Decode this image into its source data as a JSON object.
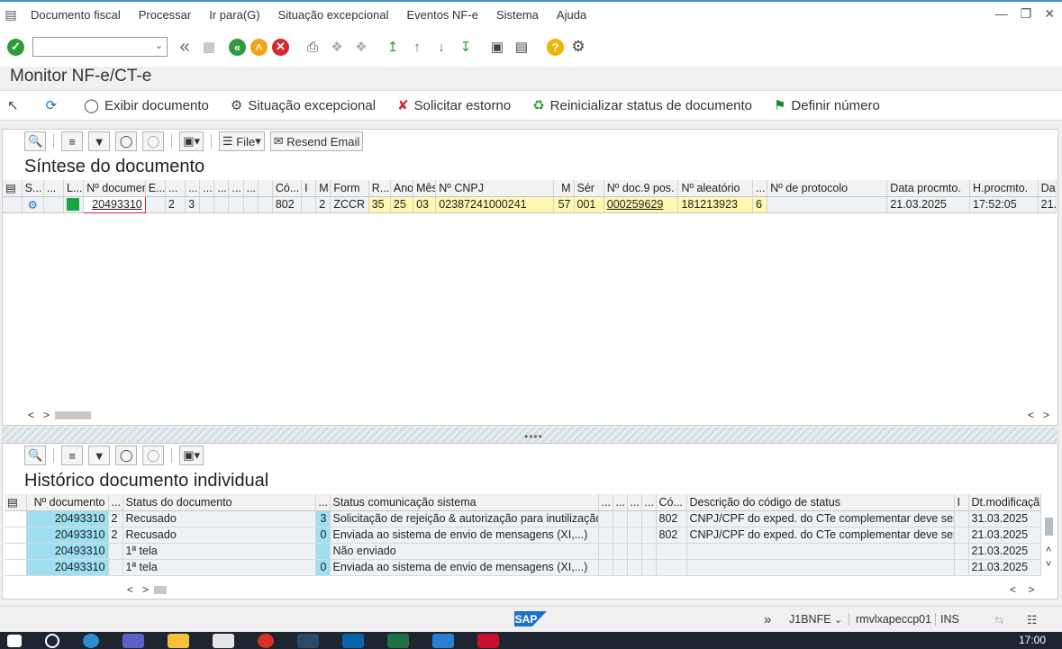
{
  "menu": {
    "items": [
      "Documento fiscal",
      "Processar",
      "Ir para(G)",
      "Situação excepcional",
      "Eventos NF-e",
      "Sistema",
      "Ajuda"
    ]
  },
  "toolbar": {
    "command_field_value": "",
    "icons": [
      "enter-icon",
      "back-double-icon",
      "save-icon",
      "back-icon",
      "exit-icon",
      "cancel-icon",
      "print-icon",
      "find-icon",
      "find-next-icon",
      "first-page-icon",
      "previous-page-icon",
      "next-page-icon",
      "last-page-icon",
      "create-session-icon",
      "shortcut-icon",
      "help-icon",
      "customize-icon"
    ]
  },
  "page": {
    "title": "Monitor NF-e/CT-e"
  },
  "app_toolbar": {
    "exibir_documento": "Exibir documento",
    "situacao_excepcional": "Situação excepcional",
    "solicitar_estorno": "Solicitar estorno",
    "reinicializar": "Reinicializar status de documento",
    "definir_numero": "Definir número"
  },
  "grid1": {
    "file_label": "File",
    "resend_label": "Resend Email",
    "title": "Síntese do documento",
    "headers": [
      "S...",
      "...",
      "L...",
      "Nº documento",
      "E...",
      "...",
      "...",
      "...",
      "...",
      "...",
      "...",
      "Có...",
      "I",
      "M",
      "Form",
      "R...",
      "Ano",
      "Mês",
      "Nº CNPJ",
      "M",
      "Sér",
      "Nº doc.9 pos.",
      "Nº aleatório",
      "...",
      "Nº de protocolo",
      "Data procmto.",
      "H.procmto.",
      "Dat"
    ],
    "row": [
      "",
      "",
      "",
      "20493310",
      "",
      "2",
      "3",
      "",
      "",
      "",
      "",
      "802",
      "",
      "2",
      "ZCCR",
      "35",
      "25",
      "03",
      "02387241000241",
      "57",
      "001",
      "000259629",
      "181213923",
      "6",
      "",
      "21.03.2025",
      "17:52:05",
      "21."
    ],
    "status_color": "#1aa543"
  },
  "grid2": {
    "title": "Histórico documento individual",
    "headers": [
      "Nº documento",
      "...",
      "Status do documento",
      "...",
      "Status comunicação sistema",
      "...",
      "...",
      "...",
      "...",
      "Có...",
      "Descrição do código de status",
      "I",
      "Dt.modificaçã"
    ],
    "rows": [
      [
        "20493310",
        "2",
        "Recusado",
        "3",
        "Solicitação de rejeição & autorização para inutilização",
        "",
        "",
        "",
        "",
        "802",
        "CNPJ/CPF do exped. do CTe complementar deve ser",
        "",
        "31.03.2025"
      ],
      [
        "20493310",
        "2",
        "Recusado",
        "0",
        "Enviada ao sistema de envio de mensagens (XI,...)",
        "",
        "",
        "",
        "",
        "802",
        "CNPJ/CPF do exped. do CTe complementar deve ser",
        "",
        "21.03.2025"
      ],
      [
        "20493310",
        "",
        "1ª tela",
        "",
        "Não enviado",
        "",
        "",
        "",
        "",
        "",
        "",
        "",
        "21.03.2025"
      ],
      [
        "20493310",
        "",
        "1ª tela",
        "0",
        "Enviada ao sistema de envio de mensagens (XI,...)",
        "",
        "",
        "",
        "",
        "",
        "",
        "",
        "21.03.2025"
      ]
    ]
  },
  "statusbar": {
    "logo": "SAP",
    "transaction": "J1BNFE",
    "server": "rmvlxapeccp01",
    "mode": "INS"
  },
  "taskbar": {
    "time": "17:00"
  },
  "colors": {
    "accent": "#3b8fd6",
    "enter_green": "#2e9a3a",
    "back_green": "#2e9a3a",
    "exit_orange": "#f2a31b",
    "cancel_red": "#d8262e",
    "help_yellow": "#f2b400",
    "row_yellow": "#fdf7b0",
    "row_blue": "#9fe0f0"
  }
}
